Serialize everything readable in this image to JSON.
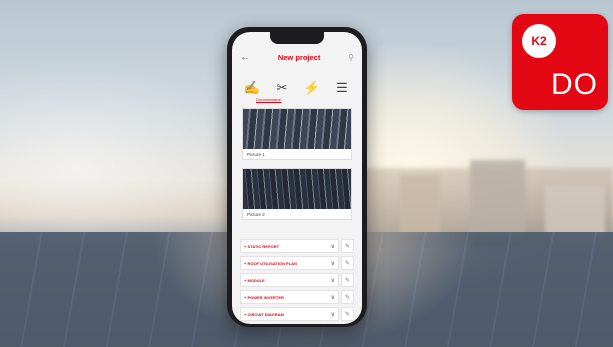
{
  "badge": {
    "logo": "K2",
    "text": "DO"
  },
  "app": {
    "title": "New project",
    "back_icon": "arrow-left-icon",
    "search_icon": "search-icon",
    "tools": [
      {
        "icon": "document-icon",
        "glyph": "✍"
      },
      {
        "icon": "tools-icon",
        "glyph": "✂"
      },
      {
        "icon": "solar-panel-icon",
        "glyph": "⚡"
      },
      {
        "icon": "checklist-icon",
        "glyph": "☰"
      }
    ],
    "tool_active_label": "Documentation",
    "pictures": [
      {
        "caption": "Picture 1"
      },
      {
        "caption": "Picture 2"
      }
    ],
    "sections": [
      {
        "label": "+ STATIC REPORT"
      },
      {
        "label": "+ ROOF UTILISATION PLAN"
      },
      {
        "label": "+ MODULE"
      },
      {
        "label": "+ POWER INVERTER"
      },
      {
        "label": "+ CIRCUIT DIAGRAM"
      }
    ]
  },
  "colors": {
    "brand_red": "#e30613"
  }
}
